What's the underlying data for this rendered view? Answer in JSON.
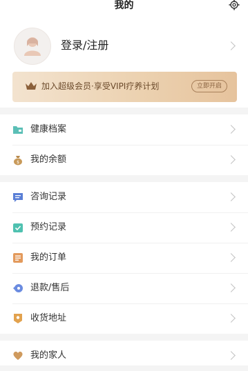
{
  "header": {
    "title": "我的"
  },
  "profile": {
    "login_label": "登录/注册"
  },
  "vip": {
    "text": "加入超级会员·享受VIPI疗养计划",
    "button_label": "立即开启"
  },
  "menu_group_1": [
    {
      "label": "健康档案",
      "icon": "folder-icon"
    },
    {
      "label": "我的余额",
      "icon": "money-bag-icon"
    }
  ],
  "menu_group_2": [
    {
      "label": "咨询记录",
      "icon": "chat-icon"
    },
    {
      "label": "预约记录",
      "icon": "check-calendar-icon"
    },
    {
      "label": "我的订单",
      "icon": "order-list-icon"
    },
    {
      "label": "退款/售后",
      "icon": "refund-icon"
    },
    {
      "label": "收货地址",
      "icon": "location-icon"
    }
  ],
  "menu_group_3": [
    {
      "label": "我的家人",
      "icon": "heart-icon"
    }
  ],
  "colors": {
    "folder": "#5bbfb6",
    "money": "#c89a5a",
    "chat": "#5a7fd6",
    "check": "#4fc1b0",
    "order": "#e39a5c",
    "refund": "#6a8be0",
    "location": "#e2a24e",
    "heart": "#cf9a5e",
    "vip_text": "#6b4a2b"
  }
}
